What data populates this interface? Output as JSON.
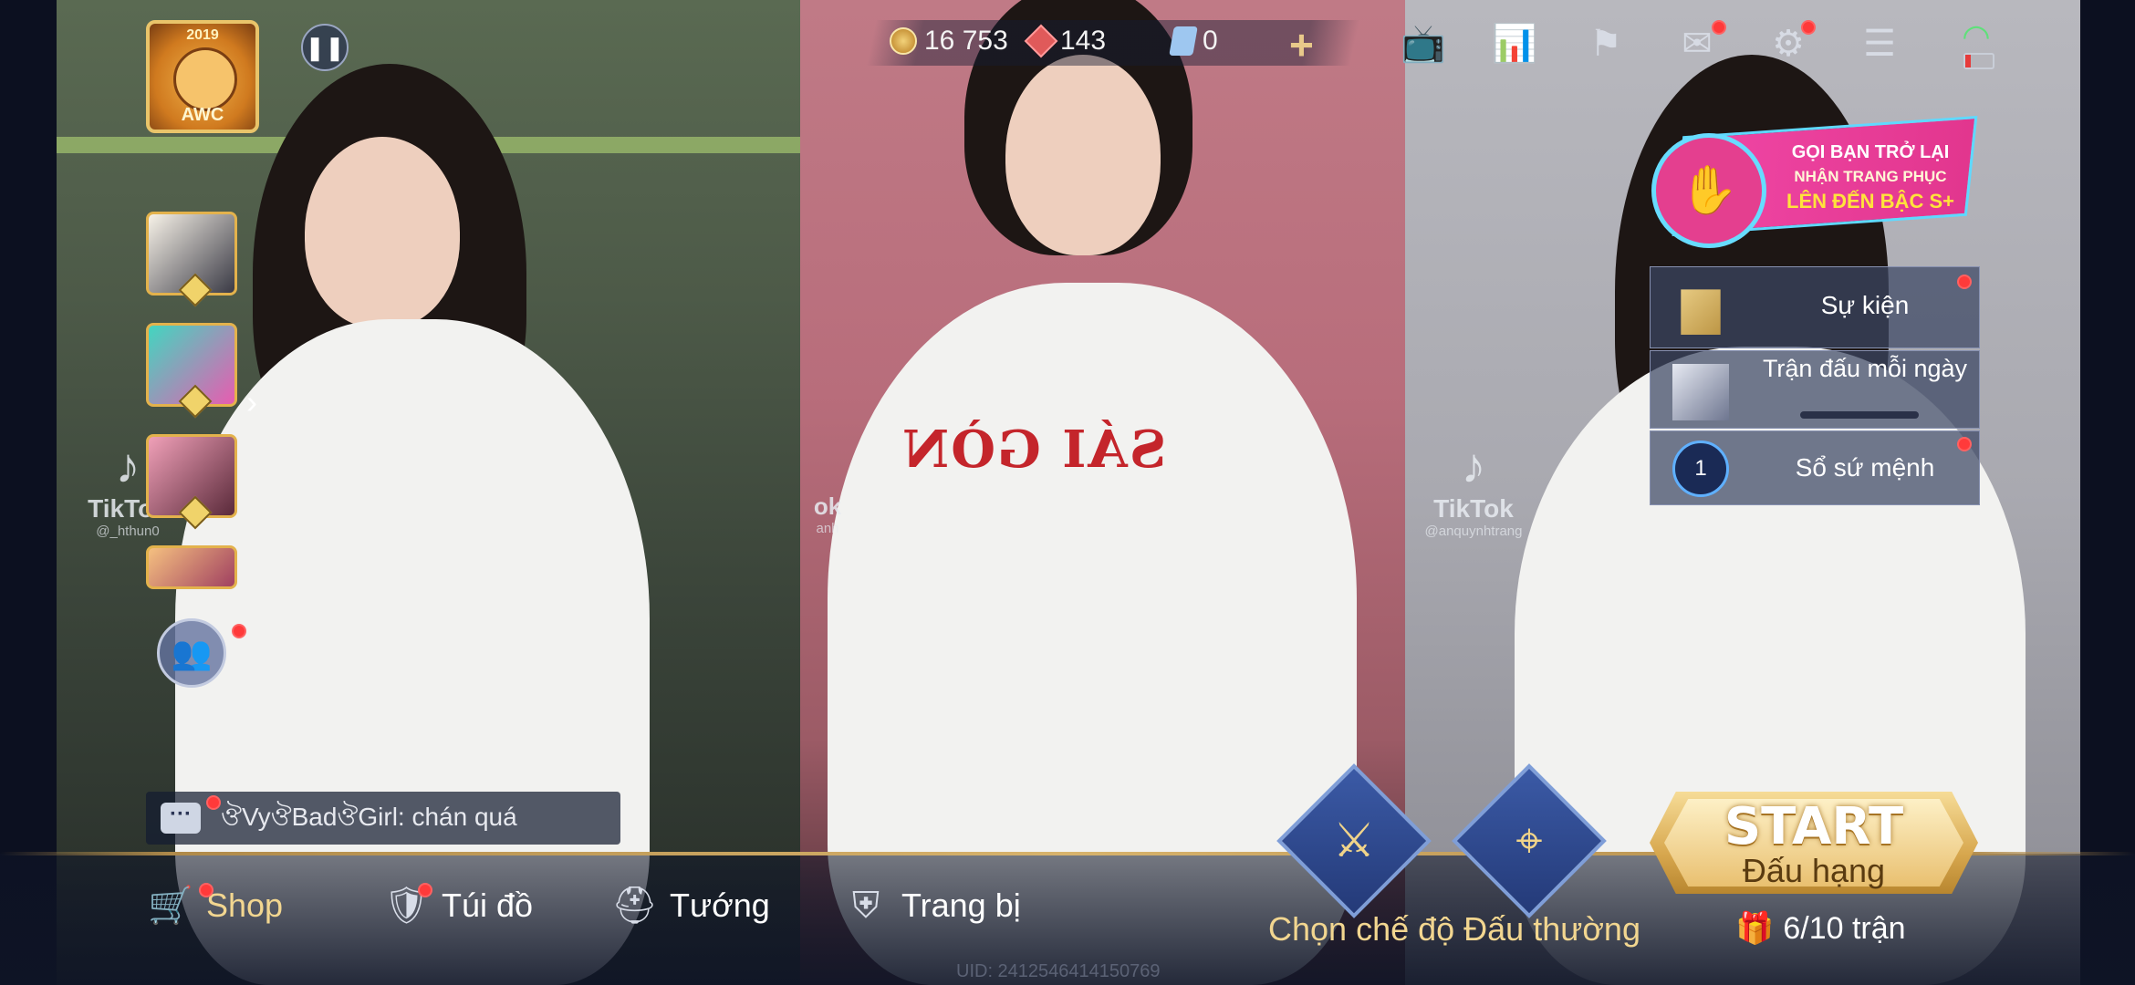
{
  "top_bar": {
    "gold": "16 753",
    "vouchers": "143",
    "tickets": "0",
    "add_label": "+"
  },
  "profile": {
    "event_year": "2019",
    "event_tag": "AWC"
  },
  "tiktok": {
    "brand": "TikTok",
    "left_handle": "@_hthun0",
    "mid_partial": "ok",
    "mid_handle": "anh",
    "right_handle": "@anquynhtrang"
  },
  "shirt_print": "SÁI GÒN",
  "chat": {
    "message": "ঔVyঔBadঔGirl: chán quá"
  },
  "event_banner": {
    "line1": "GỌI BẠN TRỞ LẠI",
    "line2": "NHẬN TRANG PHỤC",
    "line3": "LÊN ĐẾN BẬC S+"
  },
  "side_menu": {
    "events": "Sự kiện",
    "daily_match": "Trận đấu mỗi ngày",
    "mission_book": "Sổ sứ mệnh",
    "mission_level": "1"
  },
  "bottom_nav": {
    "shop": "Shop",
    "bag": "Túi đồ",
    "heroes": "Tướng",
    "equipment": "Trang bị"
  },
  "mode": {
    "label": "Chọn chế độ Đấu thường"
  },
  "start": {
    "title": "START",
    "subtitle": "Đấu hạng",
    "matches": "6/10 trận"
  },
  "uid": "UID: 2412546414150769",
  "colors": {
    "accent_gold": "#d8b36c",
    "notify_red": "#ff3a3a",
    "banner_pink": "#e43f8f"
  }
}
